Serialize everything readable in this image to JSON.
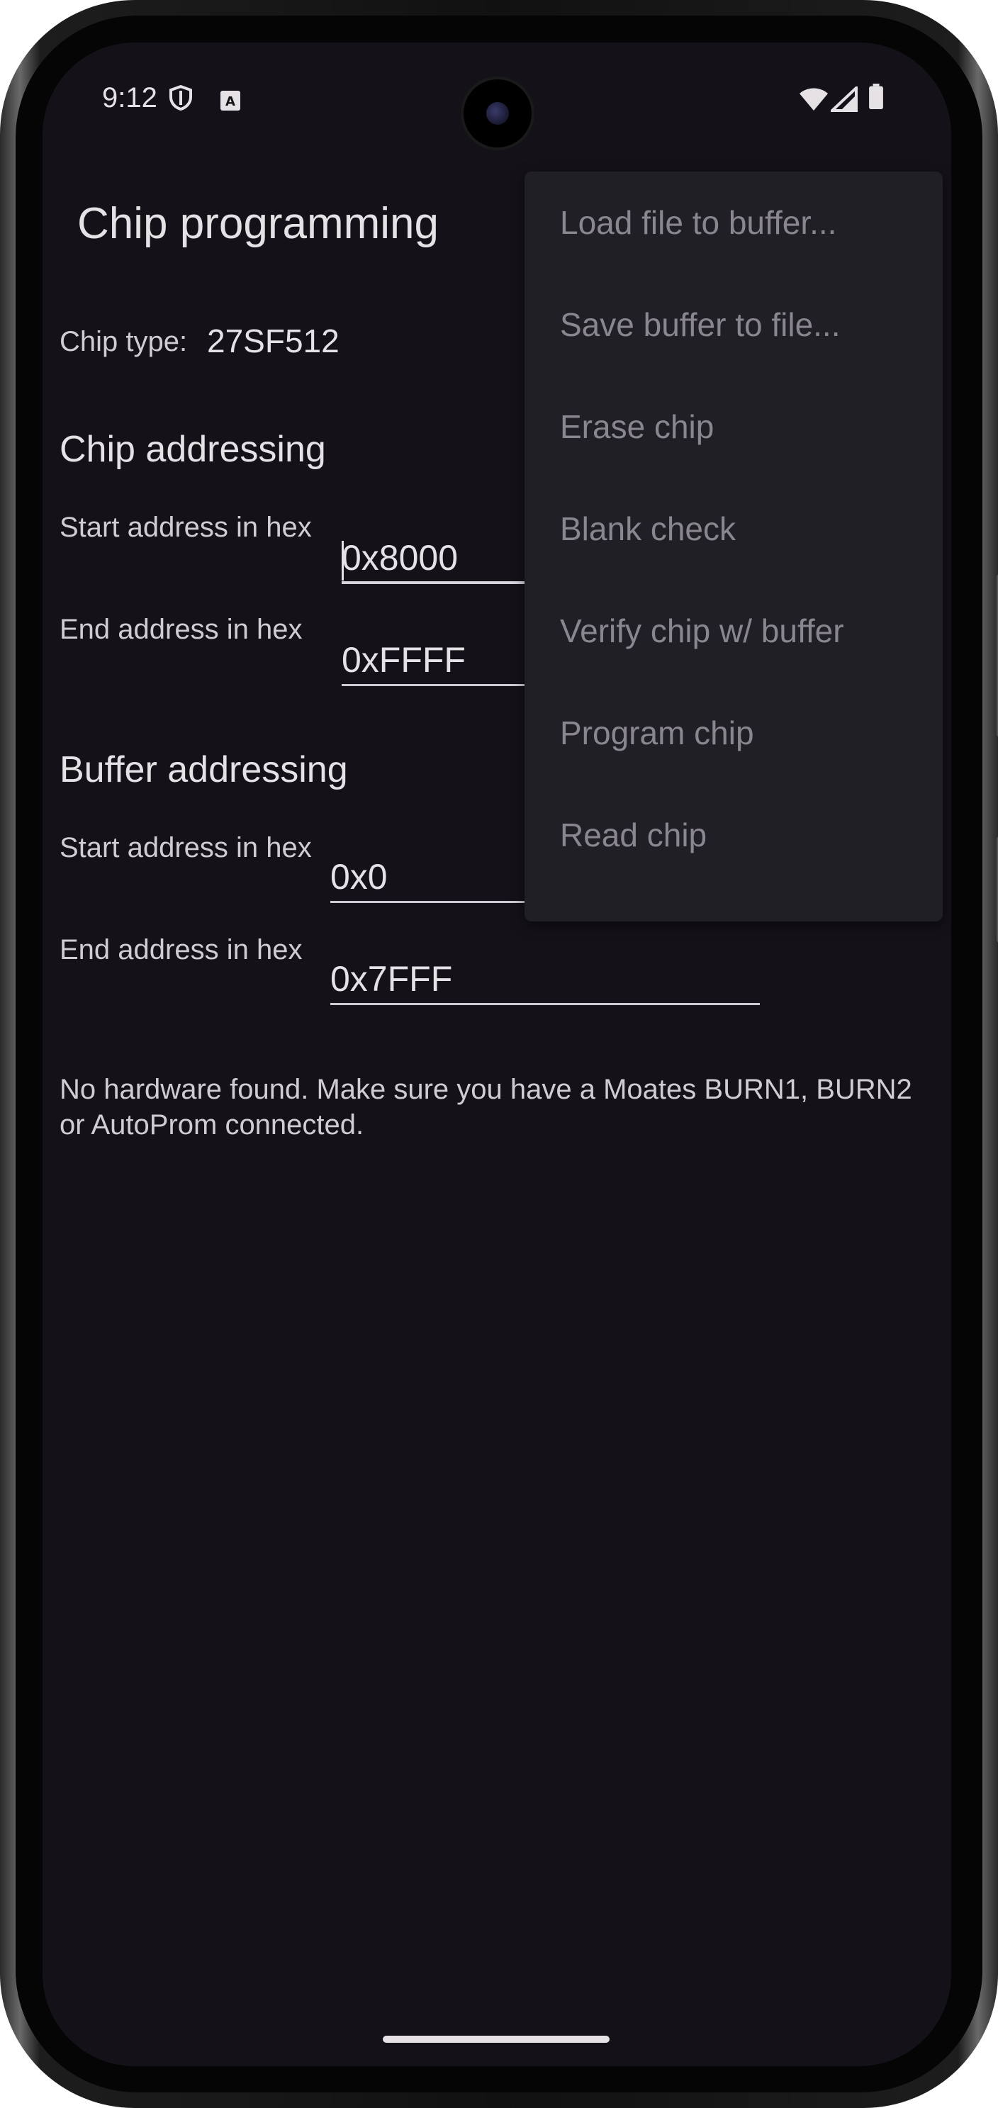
{
  "status_bar": {
    "time": "9:12",
    "icons_left": [
      "shield-icon",
      "a-badge-icon"
    ],
    "icons_right": [
      "wifi-icon",
      "cell-signal-icon",
      "battery-icon"
    ]
  },
  "app": {
    "title": "Chip programming"
  },
  "chip": {
    "type_label": "Chip type:",
    "type_value": "27SF512"
  },
  "chip_addressing": {
    "title": "Chip addressing",
    "start_label": "Start address in hex",
    "start_value": "0x8000",
    "end_label": "End address in hex",
    "end_value": "0xFFFF"
  },
  "buffer_addressing": {
    "title": "Buffer addressing",
    "start_label": "Start address in hex",
    "start_value": "0x0",
    "end_label": "End address in hex",
    "end_value": "0x7FFF"
  },
  "message": "No hardware found. Make sure you have a Moates BURN1, BURN2 or AutoProm connected.",
  "menu": {
    "items": [
      {
        "label": "Load file to buffer..."
      },
      {
        "label": "Save buffer to file..."
      },
      {
        "label": "Erase chip"
      },
      {
        "label": "Blank check"
      },
      {
        "label": "Verify chip w/ buffer"
      },
      {
        "label": "Program chip"
      },
      {
        "label": "Read chip"
      }
    ]
  },
  "colors": {
    "background": "#141218",
    "menu_background": "#211f26",
    "text": "#e6e1e5",
    "menu_text_disabled": "#8a868f"
  }
}
